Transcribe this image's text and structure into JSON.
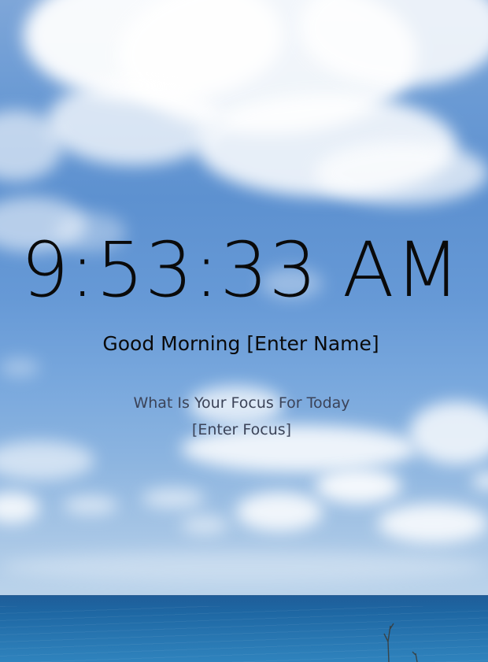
{
  "clock": {
    "time": "9:53:33 AM"
  },
  "greeting": {
    "prefix": "Good Morning ",
    "name": "[Enter Name]"
  },
  "focus": {
    "prompt": "What Is Your Focus For Today",
    "value": "[Enter Focus]"
  },
  "background": {
    "sky_color": "#6a9ad4",
    "ocean_color": "#1e67a3",
    "text_color": "#0a0a0a"
  }
}
